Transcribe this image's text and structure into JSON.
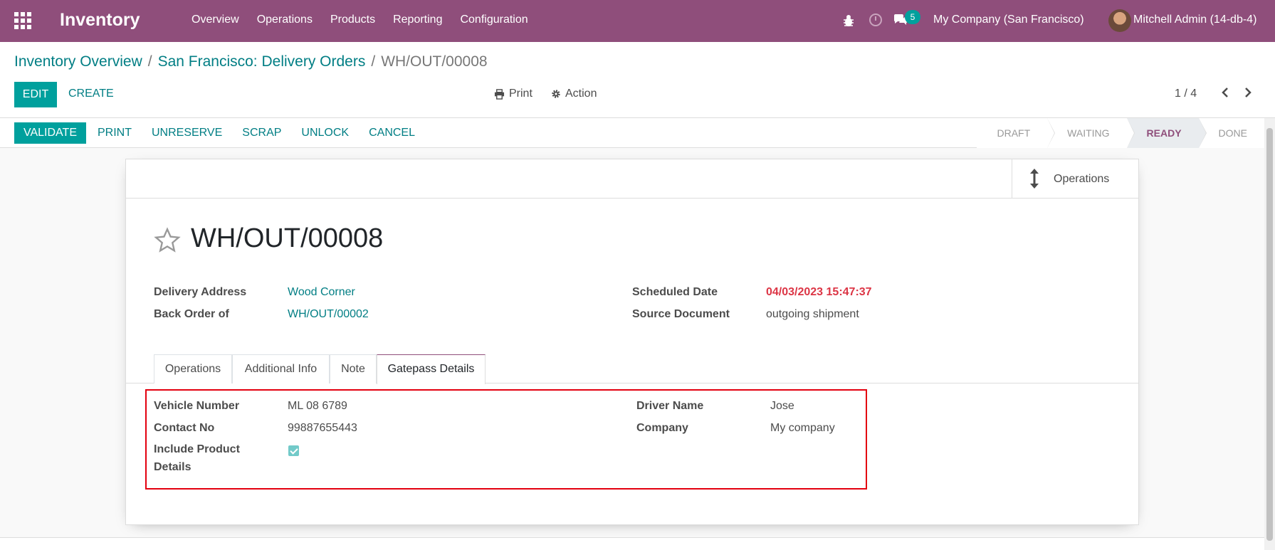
{
  "navbar": {
    "app_name": "Inventory",
    "menu": [
      "Overview",
      "Operations",
      "Products",
      "Reporting",
      "Configuration"
    ],
    "chat_count": "5",
    "company": "My Company (San Francisco)",
    "user": "Mitchell Admin (14-db-4)",
    "bg_color": "#8f4e7b"
  },
  "breadcrumb": {
    "items": [
      "Inventory Overview",
      "San Francisco: Delivery Orders"
    ],
    "current": "WH/OUT/00008"
  },
  "control": {
    "edit_label": "EDIT",
    "create_label": "CREATE",
    "print_label": "Print",
    "action_label": "Action",
    "pager": "1 / 4"
  },
  "statusbar": {
    "buttons": [
      "VALIDATE",
      "PRINT",
      "UNRESERVE",
      "SCRAP",
      "UNLOCK",
      "CANCEL"
    ],
    "stages": [
      "DRAFT",
      "WAITING",
      "READY",
      "DONE"
    ],
    "current_stage": "READY"
  },
  "sheet": {
    "ops_button_label": "Operations",
    "title": "WH/OUT/00008",
    "fields_left": [
      {
        "label": "Delivery Address",
        "value": "Wood Corner"
      },
      {
        "label": "Back Order of",
        "value": "WH/OUT/00002"
      }
    ],
    "fields_right": [
      {
        "label": "Scheduled Date",
        "value": "04/03/2023 15:47:37"
      },
      {
        "label": "Source Document",
        "value": "outgoing shipment"
      }
    ],
    "tabs": [
      "Operations",
      "Additional Info",
      "Note",
      "Gatepass Details"
    ],
    "active_tab": "Gatepass Details",
    "gatepass": {
      "vehicle_label": "Vehicle Number",
      "vehicle_value": "ML 08 6789",
      "contact_label": "Contact No",
      "contact_value": "99887655443",
      "include_label_1": "Include Product",
      "include_label_2": "Details",
      "include_checked": true,
      "driver_label": "Driver Name",
      "driver_value": "Jose",
      "company_label": "Company",
      "company_value": "My company"
    }
  },
  "colors": {
    "accent": "#00a09d",
    "link": "#017e84",
    "danger": "#dc3545",
    "highlight": "#e3000f"
  }
}
